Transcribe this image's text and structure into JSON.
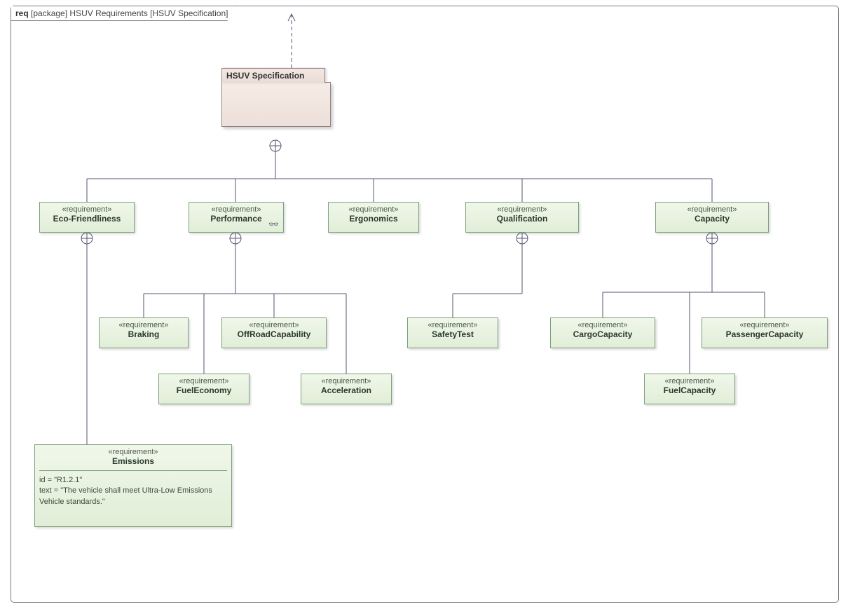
{
  "frame": {
    "kind": "req",
    "kind_context": "[package] HSUV Requirements [HSUV Specification]"
  },
  "package": {
    "name": "HSUV Specification"
  },
  "stereotype": "«requirement»",
  "reqs": {
    "eco": {
      "name": "Eco-Friendliness"
    },
    "perf": {
      "name": "Performance"
    },
    "ergo": {
      "name": "Ergonomics"
    },
    "qual": {
      "name": "Qualification"
    },
    "cap": {
      "name": "Capacity"
    },
    "braking": {
      "name": "Braking"
    },
    "offroad": {
      "name": "OffRoadCapability"
    },
    "fueleco": {
      "name": "FuelEconomy"
    },
    "accel": {
      "name": "Acceleration"
    },
    "safety": {
      "name": "SafetyTest"
    },
    "cargo": {
      "name": "CargoCapacity"
    },
    "passenger": {
      "name": "PassengerCapacity"
    },
    "fuelcap": {
      "name": "FuelCapacity"
    }
  },
  "emissions": {
    "name": "Emissions",
    "id_line": "id = \"R1.2.1\"",
    "text_line": "text = \"The vehicle shall meet Ultra-Low Emissions Vehicle standards.\""
  }
}
